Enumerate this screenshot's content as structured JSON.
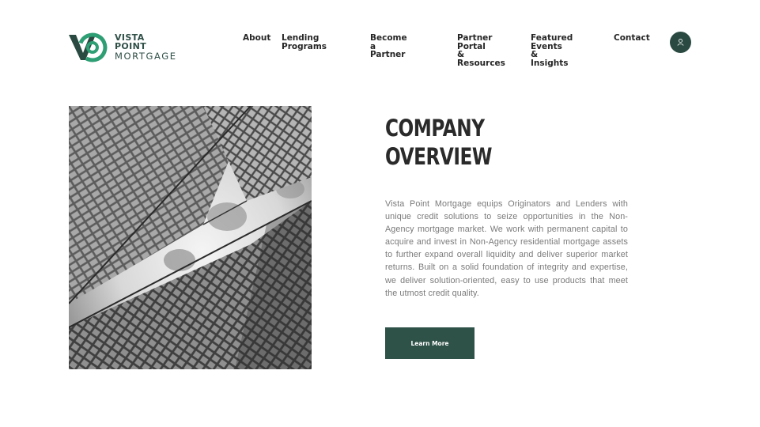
{
  "brand": {
    "name_line1": "VISTA POINT",
    "name_line2": "MORTGAGE",
    "accent_color": "#2a4a41",
    "green_color": "#2e9e74"
  },
  "nav": {
    "items": [
      {
        "label": "About"
      },
      {
        "label": "Lending Programs"
      },
      {
        "label": "Become a Partner"
      },
      {
        "label": "Partner Portal\n& Resources"
      },
      {
        "label": "Featured Events\n& Insights"
      },
      {
        "label": "Contact"
      }
    ],
    "user_icon": "user-icon"
  },
  "overview": {
    "title_line1": "COMPANY",
    "title_line2": "OVERVIEW",
    "description": "Vista Point Mortgage equips Originators and Lenders with unique credit solutions to seize opportunities in the Non-Agency mortgage market. We work with permanent capital to acquire and invest in Non-Agency residential mortgage assets to further expand overall liquidity and deliver superior market returns. Built on a solid foundation of integrity and expertise, we deliver solution-oriented, easy to use products that meet the utmost credit quality.",
    "cta_label": "Learn More",
    "image": "glass-skyscrapers-photo"
  }
}
